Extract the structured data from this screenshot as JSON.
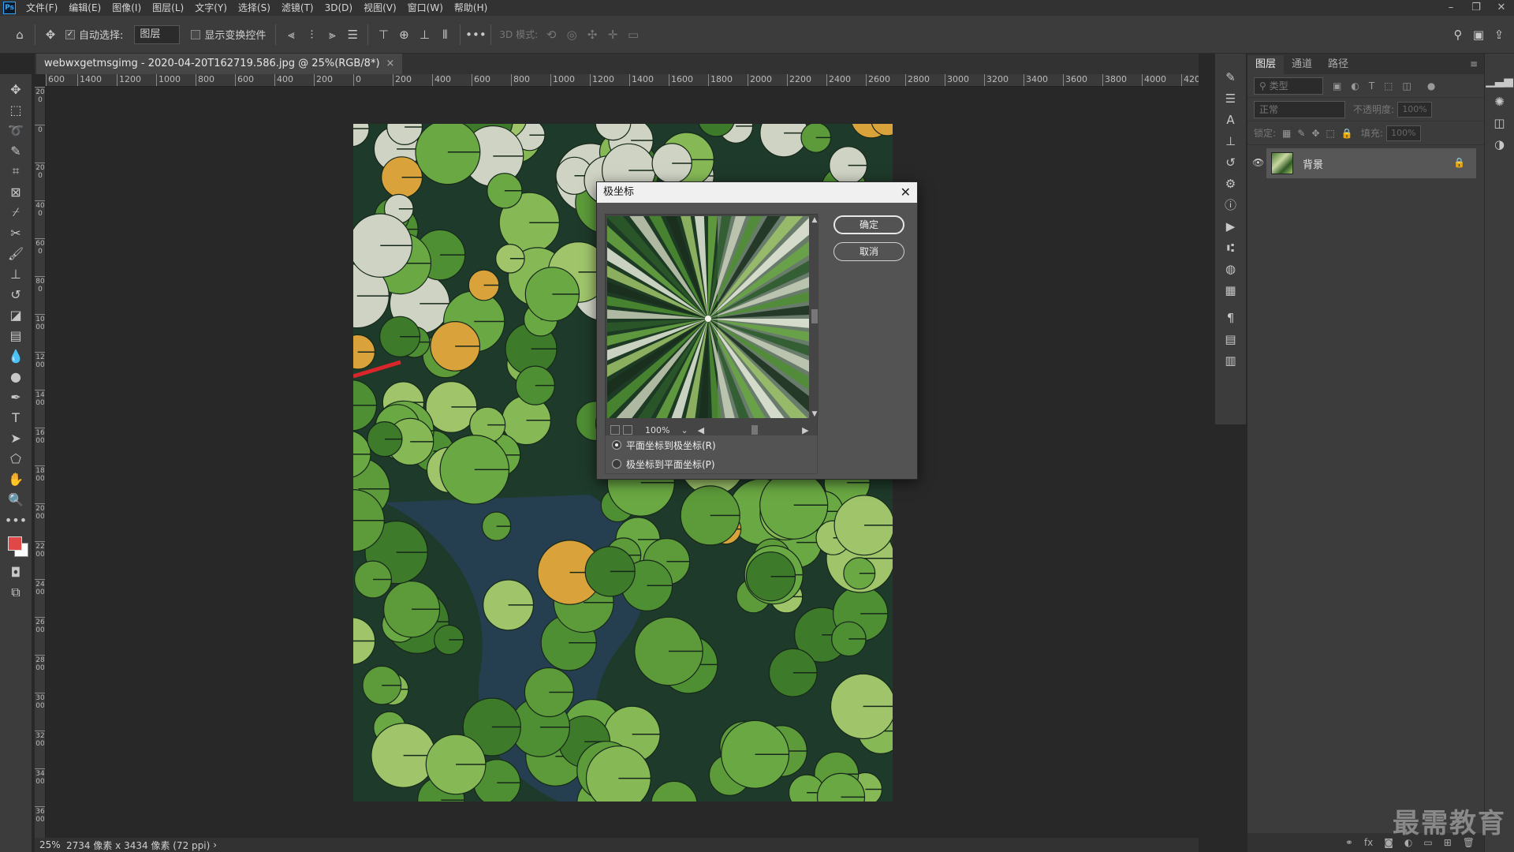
{
  "menubar": {
    "logo": "Ps",
    "items": [
      "文件(F)",
      "编辑(E)",
      "图像(I)",
      "图层(L)",
      "文字(Y)",
      "选择(S)",
      "滤镜(T)",
      "3D(D)",
      "视图(V)",
      "窗口(W)",
      "帮助(H)"
    ],
    "controls": [
      "–",
      "❐",
      "✕"
    ]
  },
  "options": {
    "auto_select_label": "自动选择:",
    "layer_select": "图层",
    "transform_label": "显示变换控件",
    "mode_3d_label": "3D 模式:"
  },
  "document": {
    "tab_title": "webwxgetmsgimg - 2020-04-20T162719.586.jpg @ 25%(RGB/8*)",
    "tab_close": "×"
  },
  "ruler": {
    "h_labels": [
      "600",
      "1400",
      "1200",
      "1000",
      "800",
      "600",
      "400",
      "200",
      "0",
      "200",
      "400",
      "600",
      "800",
      "1000",
      "1200",
      "1400",
      "1600",
      "1800",
      "2000",
      "2200",
      "2400",
      "2600",
      "2800",
      "3000",
      "3200",
      "3400",
      "3600",
      "3800",
      "4000",
      "420"
    ],
    "v_labels": [
      "200",
      "0",
      "200",
      "400",
      "600",
      "800",
      "1000",
      "1200",
      "1400",
      "1600",
      "1800",
      "2000",
      "2200",
      "2400",
      "2600",
      "2800",
      "3000",
      "3200",
      "3400",
      "3600"
    ]
  },
  "status": {
    "zoom": "25%",
    "info": "2734 像素 x 3434 像素 (72 ppi)",
    "arrow": "›"
  },
  "dialog": {
    "title": "极坐标",
    "ok": "确定",
    "cancel": "取消",
    "zoom": "100%",
    "options": [
      {
        "label": "平面坐标到极坐标(R)",
        "selected": true
      },
      {
        "label": "极坐标到平面坐标(P)",
        "selected": false
      }
    ]
  },
  "layers_panel": {
    "tabs": [
      "图层",
      "通道",
      "路径"
    ],
    "kind_placeholder": "类型",
    "blend_mode": "正常",
    "opacity_label": "不透明度:",
    "opacity_value": "100%",
    "lock_label": "锁定:",
    "fill_label": "填充:",
    "fill_value": "100%",
    "layer_name": "背景"
  },
  "watermark": "最需教育",
  "colors": {
    "foreground": "#e04848",
    "background": "#ffffff",
    "accent": "#31a8ff"
  }
}
